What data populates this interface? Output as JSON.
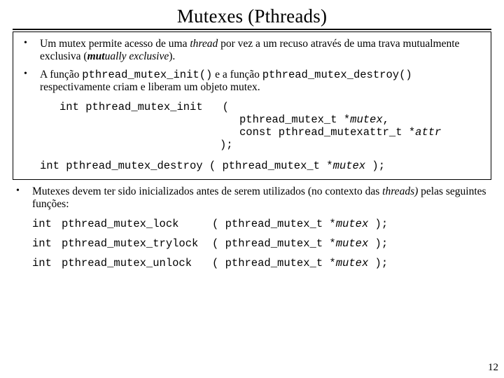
{
  "title": "Mutexes (Pthreads)",
  "bullets": {
    "b1_1": "Um mutex permite acesso de uma ",
    "b1_thread": "thread",
    "b1_2": " por vez a um recuso através de uma trava mutualmente exclusiva (",
    "b1_mut": "mut",
    "b1_ually": "ually exclusive",
    "b1_3": ").",
    "b2_1": "A função ",
    "b2_code1": "pthread_mutex_init()",
    "b2_2": " e a função ",
    "b2_code2": "pthread_mutex_destroy()",
    "b2_3": " respectivamente criam e liberam um objeto mutex.",
    "b3_1": "Mutexes devem ter sido inicializados antes de serem utilizados (no contexto das ",
    "b3_threads": "threads)",
    "b3_2": " pelas seguintes funções:"
  },
  "protos": {
    "ret": "int",
    "init_name": "pthread_mutex_init",
    "init_p1": "pthread_mutex_t *",
    "init_p1i": "mutex",
    "init_p1c": ",",
    "init_p2": "const pthread_mutexattr_t *",
    "init_p2i": "attr",
    "init_close": ");",
    "destroy": "pthread_mutex_destroy ( pthread_mutex_t *",
    "destroy_i": "mutex",
    "destroy_end": " );",
    "lock": "pthread_mutex_lock",
    "trylock": "pthread_mutex_trylock",
    "unlock": "pthread_mutex_unlock",
    "arg_open": "( pthread_mutex_t *",
    "arg_i": "mutex",
    "arg_close": " );"
  },
  "pagenum": "12"
}
